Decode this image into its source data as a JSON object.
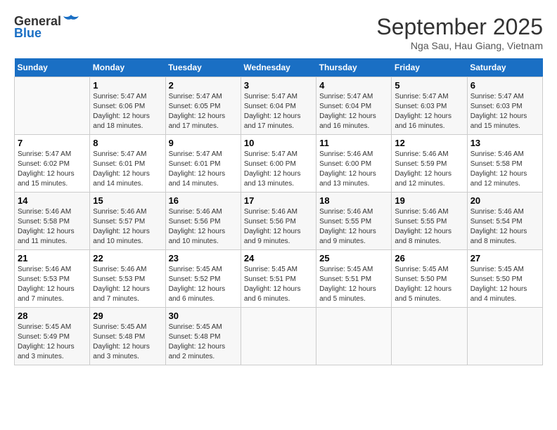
{
  "header": {
    "logo_line1": "General",
    "logo_line2": "Blue",
    "month": "September 2025",
    "location": "Nga Sau, Hau Giang, Vietnam"
  },
  "days_of_week": [
    "Sunday",
    "Monday",
    "Tuesday",
    "Wednesday",
    "Thursday",
    "Friday",
    "Saturday"
  ],
  "weeks": [
    [
      {
        "day": "",
        "info": ""
      },
      {
        "day": "1",
        "info": "Sunrise: 5:47 AM\nSunset: 6:06 PM\nDaylight: 12 hours and 18 minutes."
      },
      {
        "day": "2",
        "info": "Sunrise: 5:47 AM\nSunset: 6:05 PM\nDaylight: 12 hours and 17 minutes."
      },
      {
        "day": "3",
        "info": "Sunrise: 5:47 AM\nSunset: 6:04 PM\nDaylight: 12 hours and 17 minutes."
      },
      {
        "day": "4",
        "info": "Sunrise: 5:47 AM\nSunset: 6:04 PM\nDaylight: 12 hours and 16 minutes."
      },
      {
        "day": "5",
        "info": "Sunrise: 5:47 AM\nSunset: 6:03 PM\nDaylight: 12 hours and 16 minutes."
      },
      {
        "day": "6",
        "info": "Sunrise: 5:47 AM\nSunset: 6:03 PM\nDaylight: 12 hours and 15 minutes."
      }
    ],
    [
      {
        "day": "7",
        "info": "Sunrise: 5:47 AM\nSunset: 6:02 PM\nDaylight: 12 hours and 15 minutes."
      },
      {
        "day": "8",
        "info": "Sunrise: 5:47 AM\nSunset: 6:01 PM\nDaylight: 12 hours and 14 minutes."
      },
      {
        "day": "9",
        "info": "Sunrise: 5:47 AM\nSunset: 6:01 PM\nDaylight: 12 hours and 14 minutes."
      },
      {
        "day": "10",
        "info": "Sunrise: 5:47 AM\nSunset: 6:00 PM\nDaylight: 12 hours and 13 minutes."
      },
      {
        "day": "11",
        "info": "Sunrise: 5:46 AM\nSunset: 6:00 PM\nDaylight: 12 hours and 13 minutes."
      },
      {
        "day": "12",
        "info": "Sunrise: 5:46 AM\nSunset: 5:59 PM\nDaylight: 12 hours and 12 minutes."
      },
      {
        "day": "13",
        "info": "Sunrise: 5:46 AM\nSunset: 5:58 PM\nDaylight: 12 hours and 12 minutes."
      }
    ],
    [
      {
        "day": "14",
        "info": "Sunrise: 5:46 AM\nSunset: 5:58 PM\nDaylight: 12 hours and 11 minutes."
      },
      {
        "day": "15",
        "info": "Sunrise: 5:46 AM\nSunset: 5:57 PM\nDaylight: 12 hours and 10 minutes."
      },
      {
        "day": "16",
        "info": "Sunrise: 5:46 AM\nSunset: 5:56 PM\nDaylight: 12 hours and 10 minutes."
      },
      {
        "day": "17",
        "info": "Sunrise: 5:46 AM\nSunset: 5:56 PM\nDaylight: 12 hours and 9 minutes."
      },
      {
        "day": "18",
        "info": "Sunrise: 5:46 AM\nSunset: 5:55 PM\nDaylight: 12 hours and 9 minutes."
      },
      {
        "day": "19",
        "info": "Sunrise: 5:46 AM\nSunset: 5:55 PM\nDaylight: 12 hours and 8 minutes."
      },
      {
        "day": "20",
        "info": "Sunrise: 5:46 AM\nSunset: 5:54 PM\nDaylight: 12 hours and 8 minutes."
      }
    ],
    [
      {
        "day": "21",
        "info": "Sunrise: 5:46 AM\nSunset: 5:53 PM\nDaylight: 12 hours and 7 minutes."
      },
      {
        "day": "22",
        "info": "Sunrise: 5:46 AM\nSunset: 5:53 PM\nDaylight: 12 hours and 7 minutes."
      },
      {
        "day": "23",
        "info": "Sunrise: 5:45 AM\nSunset: 5:52 PM\nDaylight: 12 hours and 6 minutes."
      },
      {
        "day": "24",
        "info": "Sunrise: 5:45 AM\nSunset: 5:51 PM\nDaylight: 12 hours and 6 minutes."
      },
      {
        "day": "25",
        "info": "Sunrise: 5:45 AM\nSunset: 5:51 PM\nDaylight: 12 hours and 5 minutes."
      },
      {
        "day": "26",
        "info": "Sunrise: 5:45 AM\nSunset: 5:50 PM\nDaylight: 12 hours and 5 minutes."
      },
      {
        "day": "27",
        "info": "Sunrise: 5:45 AM\nSunset: 5:50 PM\nDaylight: 12 hours and 4 minutes."
      }
    ],
    [
      {
        "day": "28",
        "info": "Sunrise: 5:45 AM\nSunset: 5:49 PM\nDaylight: 12 hours and 3 minutes."
      },
      {
        "day": "29",
        "info": "Sunrise: 5:45 AM\nSunset: 5:48 PM\nDaylight: 12 hours and 3 minutes."
      },
      {
        "day": "30",
        "info": "Sunrise: 5:45 AM\nSunset: 5:48 PM\nDaylight: 12 hours and 2 minutes."
      },
      {
        "day": "",
        "info": ""
      },
      {
        "day": "",
        "info": ""
      },
      {
        "day": "",
        "info": ""
      },
      {
        "day": "",
        "info": ""
      }
    ]
  ]
}
